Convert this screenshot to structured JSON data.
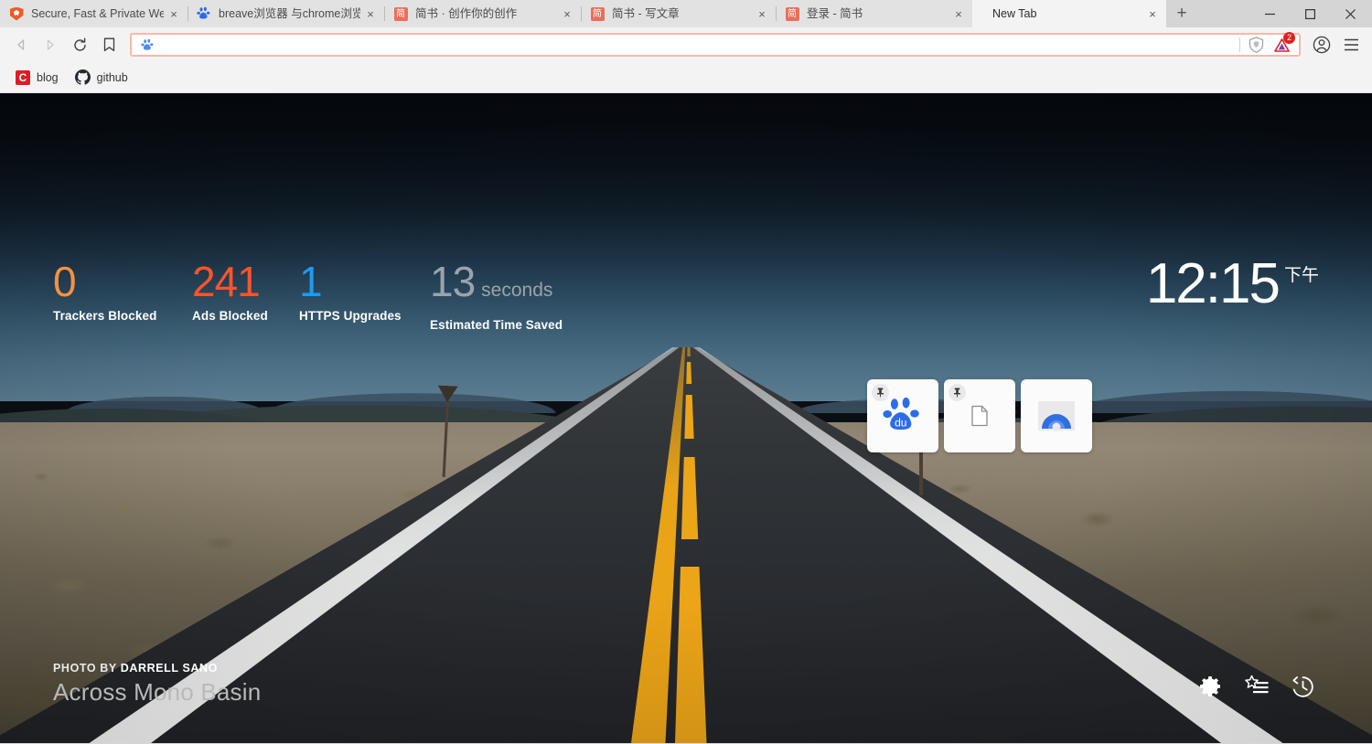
{
  "window": {
    "minimize_label": "Minimize",
    "maximize_label": "Maximize",
    "close_label": "Close"
  },
  "tabstrip": {
    "new_tab_label": "+",
    "close_glyph": "×",
    "tabs": [
      {
        "title": "Secure, Fast & Private Web ",
        "favicon": "brave-lion-icon",
        "active": false
      },
      {
        "title": "breave浏览器 与chrome浏览",
        "favicon": "baidu-paw-icon",
        "active": false
      },
      {
        "title": "简书 · 创作你的创作",
        "favicon": "jianshu-icon",
        "favicon_text": "简",
        "active": false
      },
      {
        "title": "简书 - 写文章",
        "favicon": "jianshu-icon",
        "favicon_text": "简",
        "active": false
      },
      {
        "title": "登录 - 简书",
        "favicon": "jianshu-icon",
        "favicon_text": "简",
        "active": false
      },
      {
        "title": "New Tab",
        "favicon": "none",
        "active": true
      }
    ]
  },
  "toolbar": {
    "back_label": "Back",
    "forward_label": "Forward",
    "reload_label": "Reload",
    "bookmark_label": "Bookmark this page",
    "omnibox_value": "",
    "omnibox_placeholder": "",
    "shields_label": "Brave Shields",
    "rewards_label": "Brave Rewards",
    "rewards_badge": "2",
    "profile_label": "Profile",
    "menu_label": "Customize and control Brave"
  },
  "bookmarks_bar": {
    "items": [
      {
        "label": "blog",
        "icon": "c-logo-icon",
        "icon_text": "C"
      },
      {
        "label": "github",
        "icon": "github-octocat-icon"
      }
    ]
  },
  "newtab": {
    "stats": [
      {
        "value": "0",
        "unit": "",
        "label": "Trackers Blocked",
        "color": "#f59140"
      },
      {
        "value": "241",
        "unit": "",
        "label": "Ads Blocked",
        "color": "#fb542b"
      },
      {
        "value": "1",
        "unit": "",
        "label": "HTTPS Upgrades",
        "color": "#1d9bf0"
      },
      {
        "value": "13",
        "unit": "seconds",
        "label": "Estimated Time Saved",
        "color": "#9aa3ab"
      }
    ],
    "clock": {
      "time": "12:15",
      "ampm": "下午"
    },
    "tiles": [
      {
        "name": "baidu-tile",
        "icon": "baidu-paw-icon",
        "pinned": true,
        "pin_glyph": "📌"
      },
      {
        "name": "document-tile",
        "icon": "document-icon",
        "pinned": true,
        "pin_glyph": "📌"
      },
      {
        "name": "arc-tile",
        "icon": "blue-arc-icon",
        "pinned": false
      }
    ],
    "credit": {
      "prefix": "PHOTO BY ",
      "author": "DARRELL SANO",
      "title": "Across Mono Basin"
    },
    "actions": [
      {
        "name": "settings-icon",
        "label": "Customize"
      },
      {
        "name": "bookmarks-icon",
        "label": "Bookmarks"
      },
      {
        "name": "history-icon",
        "label": "History"
      }
    ]
  }
}
